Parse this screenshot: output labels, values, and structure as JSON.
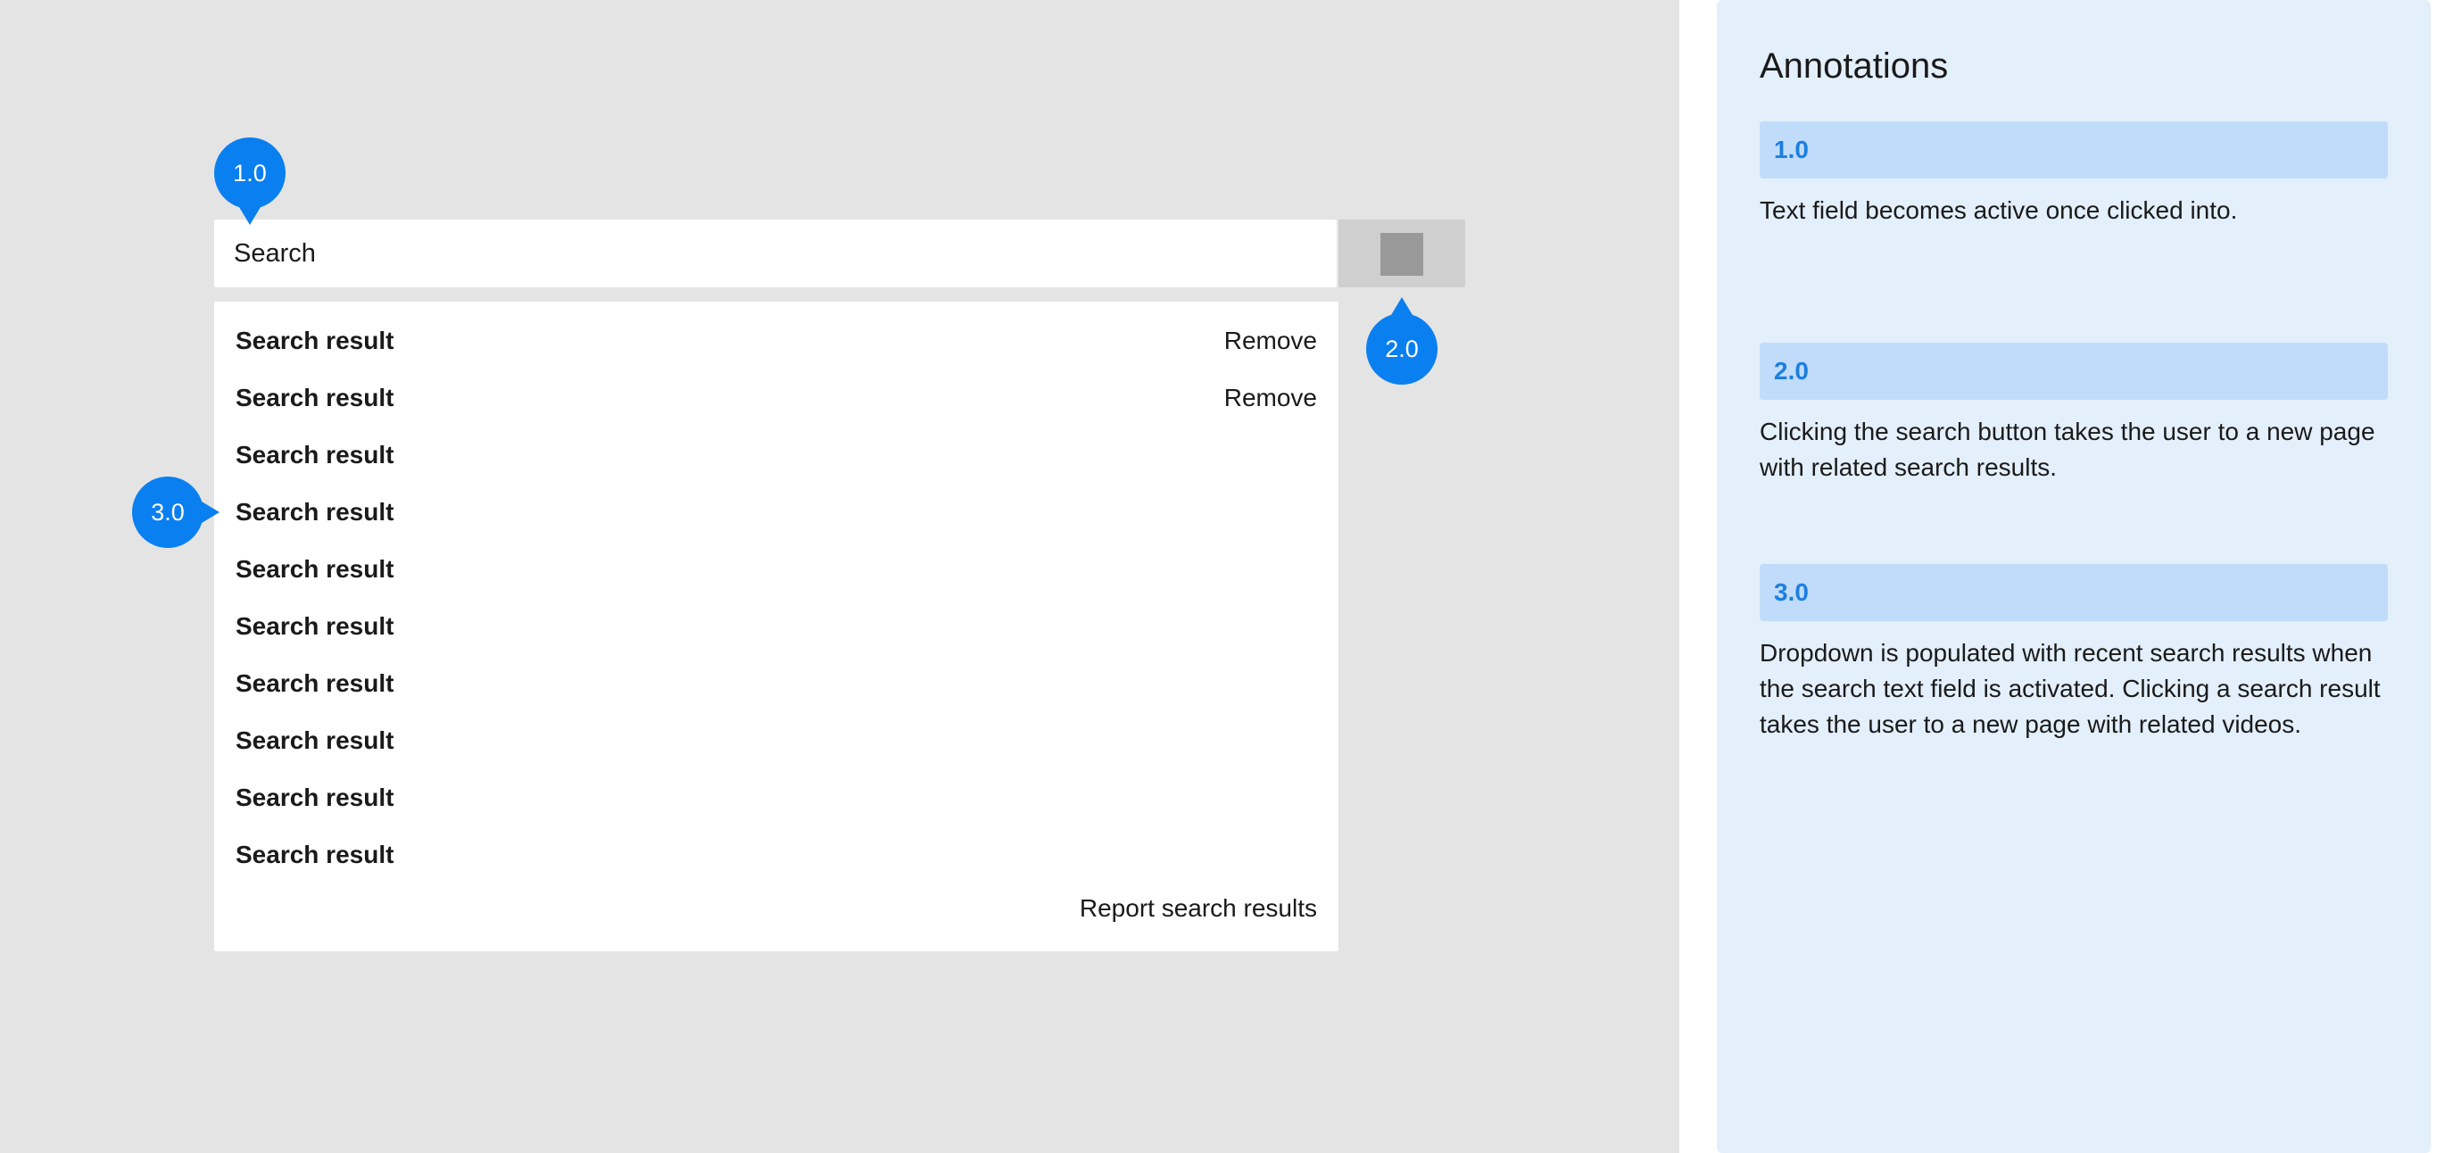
{
  "search": {
    "placeholder": "Search"
  },
  "dropdown": {
    "results": [
      {
        "label": "Search result",
        "action": "Remove"
      },
      {
        "label": "Search result",
        "action": "Remove"
      },
      {
        "label": "Search result",
        "action": ""
      },
      {
        "label": "Search result",
        "action": ""
      },
      {
        "label": "Search result",
        "action": ""
      },
      {
        "label": "Search result",
        "action": ""
      },
      {
        "label": "Search result",
        "action": ""
      },
      {
        "label": "Search result",
        "action": ""
      },
      {
        "label": "Search result",
        "action": ""
      },
      {
        "label": "Search result",
        "action": ""
      }
    ],
    "report_label": "Report search results"
  },
  "markers": [
    "1.0",
    "2.0",
    "3.0"
  ],
  "annotations": {
    "title": "Annotations",
    "items": [
      {
        "tag": "1.0",
        "text": "Text field becomes active once clicked into."
      },
      {
        "tag": "2.0",
        "text": "Clicking the search button takes the user to a new page with related search results."
      },
      {
        "tag": "3.0",
        "text": "Dropdown is populated with recent search results when the search text field is activated. Clicking a search result takes the user to a new page with related videos."
      }
    ]
  },
  "colors": {
    "canvas": "#e4e4e4",
    "marker": "#0a7ff0",
    "panel": "#e3effb",
    "annotation_tag": "#c0dcfa",
    "annotation_tag_text": "#1c7fe0"
  }
}
